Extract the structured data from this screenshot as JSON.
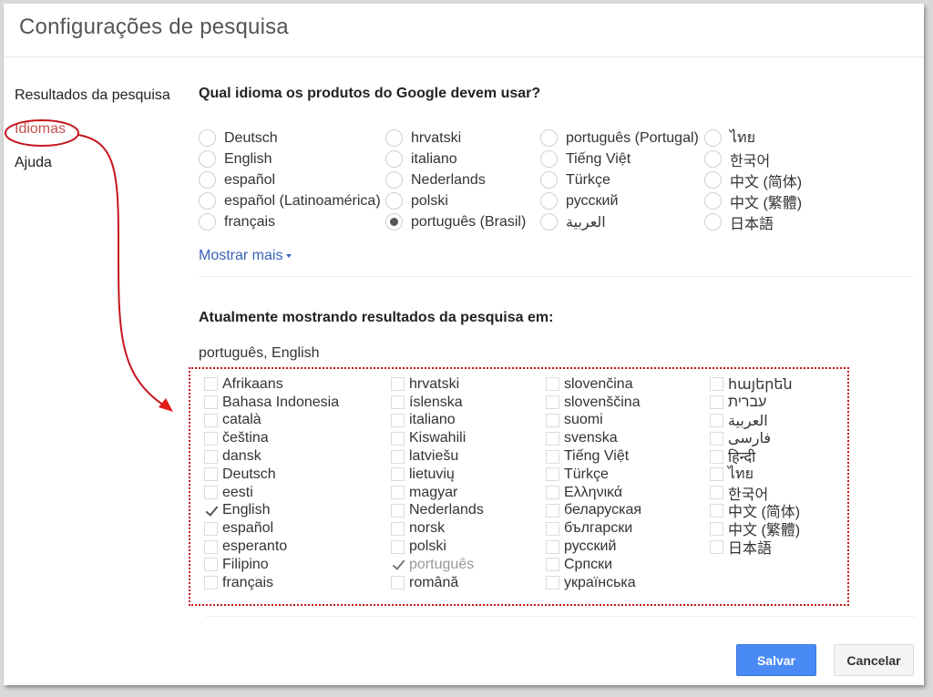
{
  "header": {
    "title": "Configurações de pesquisa"
  },
  "sidebar": {
    "items": [
      {
        "label": "Resultados da pesquisa",
        "active": false
      },
      {
        "label": "Idiomas",
        "active": true
      },
      {
        "label": "Ajuda",
        "active": false
      }
    ]
  },
  "product_language": {
    "title": "Qual idioma os produtos do Google devem usar?",
    "selected": "português (Brasil)",
    "options": [
      "Deutsch",
      "English",
      "español",
      "español (Latinoamérica)",
      "français",
      "hrvatski",
      "italiano",
      "Nederlands",
      "polski",
      "português (Brasil)",
      "português (Portugal)",
      "Tiếng Việt",
      "Türkçe",
      "русский",
      "العربية",
      "ไทย",
      "한국어",
      "中文 (简体)",
      "中文 (繁體)",
      "日本語"
    ],
    "show_more_label": "Mostrar mais"
  },
  "search_languages": {
    "title": "Atualmente mostrando resultados da pesquisa em:",
    "current": "português, English",
    "columns": [
      [
        {
          "label": "Afrikaans"
        },
        {
          "label": "Bahasa Indonesia"
        },
        {
          "label": "català"
        },
        {
          "label": "čeština"
        },
        {
          "label": "dansk"
        },
        {
          "label": "Deutsch"
        },
        {
          "label": "eesti"
        },
        {
          "label": "English",
          "checked": true
        },
        {
          "label": "español"
        },
        {
          "label": "esperanto"
        },
        {
          "label": "Filipino"
        },
        {
          "label": "français"
        }
      ],
      [
        {
          "label": "hrvatski"
        },
        {
          "label": "íslenska"
        },
        {
          "label": "italiano"
        },
        {
          "label": "Kiswahili"
        },
        {
          "label": "latviešu"
        },
        {
          "label": "lietuvių"
        },
        {
          "label": "magyar"
        },
        {
          "label": "Nederlands"
        },
        {
          "label": "norsk"
        },
        {
          "label": "polski"
        },
        {
          "label": "português",
          "checked": true,
          "disabled": true
        },
        {
          "label": "română"
        }
      ],
      [
        {
          "label": "slovenčina"
        },
        {
          "label": "slovenščina"
        },
        {
          "label": "suomi"
        },
        {
          "label": "svenska"
        },
        {
          "label": "Tiếng Việt"
        },
        {
          "label": "Türkçe"
        },
        {
          "label": "Ελληνικά"
        },
        {
          "label": "беларуская"
        },
        {
          "label": "български"
        },
        {
          "label": "русский"
        },
        {
          "label": "Српски"
        },
        {
          "label": "українська"
        }
      ],
      [
        {
          "label": "հայերեն"
        },
        {
          "label": "עברית"
        },
        {
          "label": "العربية"
        },
        {
          "label": "فارسی"
        },
        {
          "label": "हिन्दी"
        },
        {
          "label": "ไทย"
        },
        {
          "label": "한국어"
        },
        {
          "label": "中文 (简体)"
        },
        {
          "label": "中文 (繁體)"
        },
        {
          "label": "日本語"
        }
      ]
    ]
  },
  "footer": {
    "save_label": "Salvar",
    "cancel_label": "Cancelar"
  },
  "colors": {
    "accent_blue": "#4a8af4",
    "link_blue": "#3a63b8",
    "active_sidebar": "#c5514e",
    "annotation_red": "#c4161c"
  }
}
